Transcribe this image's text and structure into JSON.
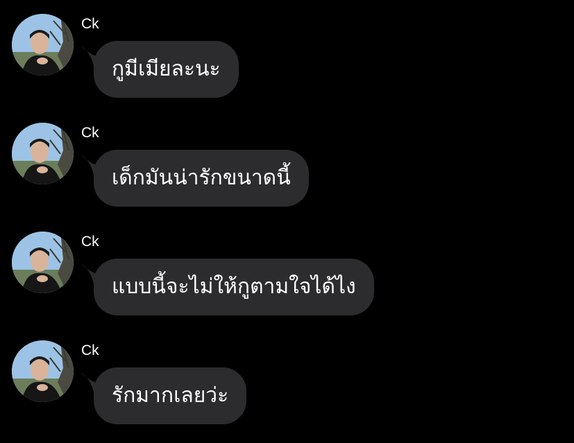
{
  "chat": {
    "messages": [
      {
        "sender": "Ck",
        "text": "กูมีเมียละนะ",
        "avatar": "profile-photo"
      },
      {
        "sender": "Ck",
        "text": "เด็กมันน่ารักขนาดนี้",
        "avatar": "profile-photo"
      },
      {
        "sender": "Ck",
        "text": "แบบนี้จะไม่ให้กูตามใจได้ไง",
        "avatar": "profile-photo"
      },
      {
        "sender": "Ck",
        "text": "รักมากเลยว่ะ",
        "avatar": "profile-photo"
      }
    ]
  },
  "colors": {
    "background": "#000000",
    "bubble": "#2c2c2e",
    "text": "#ffffff"
  }
}
